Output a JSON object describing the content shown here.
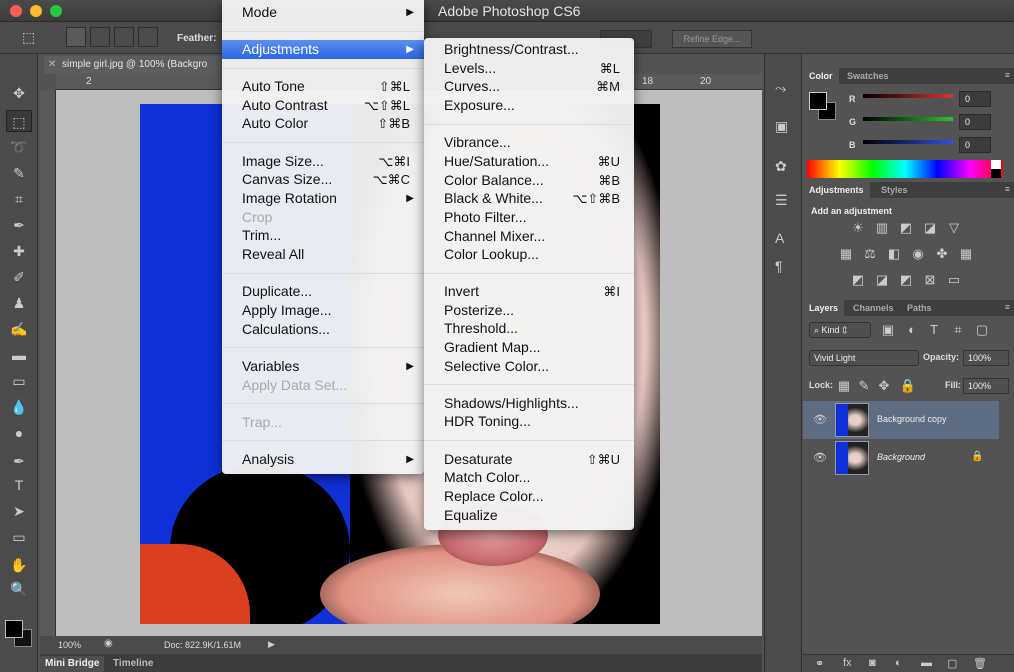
{
  "window": {
    "title": "Adobe Photoshop CS6"
  },
  "options_bar": {
    "feather_label": "Feather:",
    "refine_edge_label": "Refine Edge..."
  },
  "document": {
    "tab_label": "simple girl.jpg @ 100% (Backgro",
    "ruler_numbers": [
      "2",
      "18",
      "20"
    ],
    "zoom": "100%",
    "doc_size": "Doc: 822.9K/1.61M"
  },
  "bottom_tabs": [
    "Mini Bridge",
    "Timeline"
  ],
  "image_menu": {
    "items": [
      {
        "label": "Mode",
        "shortcut": "",
        "arrow": "▶",
        "state": "normal"
      },
      {
        "label": "Adjustments",
        "shortcut": "",
        "arrow": "▶",
        "state": "highlighted"
      },
      {
        "label": "Auto Tone",
        "shortcut": "⇧⌘L",
        "arrow": "",
        "state": "normal"
      },
      {
        "label": "Auto Contrast",
        "shortcut": "⌥⇧⌘L",
        "arrow": "",
        "state": "normal"
      },
      {
        "label": "Auto Color",
        "shortcut": "⇧⌘B",
        "arrow": "",
        "state": "normal"
      },
      {
        "label": "Image Size...",
        "shortcut": "⌥⌘I",
        "arrow": "",
        "state": "normal"
      },
      {
        "label": "Canvas Size...",
        "shortcut": "⌥⌘C",
        "arrow": "",
        "state": "normal"
      },
      {
        "label": "Image Rotation",
        "shortcut": "",
        "arrow": "▶",
        "state": "normal"
      },
      {
        "label": "Crop",
        "shortcut": "",
        "arrow": "",
        "state": "disabled"
      },
      {
        "label": "Trim...",
        "shortcut": "",
        "arrow": "",
        "state": "normal"
      },
      {
        "label": "Reveal All",
        "shortcut": "",
        "arrow": "",
        "state": "normal"
      },
      {
        "label": "Duplicate...",
        "shortcut": "",
        "arrow": "",
        "state": "normal"
      },
      {
        "label": "Apply Image...",
        "shortcut": "",
        "arrow": "",
        "state": "normal"
      },
      {
        "label": "Calculations...",
        "shortcut": "",
        "arrow": "",
        "state": "normal"
      },
      {
        "label": "Variables",
        "shortcut": "",
        "arrow": "▶",
        "state": "normal"
      },
      {
        "label": "Apply Data Set...",
        "shortcut": "",
        "arrow": "",
        "state": "disabled"
      },
      {
        "label": "Trap...",
        "shortcut": "",
        "arrow": "",
        "state": "disabled"
      },
      {
        "label": "Analysis",
        "shortcut": "",
        "arrow": "▶",
        "state": "normal"
      }
    ]
  },
  "adjustments_menu": {
    "items": [
      {
        "label": "Brightness/Contrast...",
        "shortcut": ""
      },
      {
        "label": "Levels...",
        "shortcut": "⌘L"
      },
      {
        "label": "Curves...",
        "shortcut": "⌘M"
      },
      {
        "label": "Exposure...",
        "shortcut": ""
      },
      {
        "label": "Vibrance...",
        "shortcut": ""
      },
      {
        "label": "Hue/Saturation...",
        "shortcut": "⌘U"
      },
      {
        "label": "Color Balance...",
        "shortcut": "⌘B"
      },
      {
        "label": "Black & White...",
        "shortcut": "⌥⇧⌘B"
      },
      {
        "label": "Photo Filter...",
        "shortcut": ""
      },
      {
        "label": "Channel Mixer...",
        "shortcut": ""
      },
      {
        "label": "Color Lookup...",
        "shortcut": ""
      },
      {
        "label": "Invert",
        "shortcut": "⌘I"
      },
      {
        "label": "Posterize...",
        "shortcut": ""
      },
      {
        "label": "Threshold...",
        "shortcut": ""
      },
      {
        "label": "Gradient Map...",
        "shortcut": ""
      },
      {
        "label": "Selective Color...",
        "shortcut": ""
      },
      {
        "label": "Shadows/Highlights...",
        "shortcut": ""
      },
      {
        "label": "HDR Toning...",
        "shortcut": ""
      },
      {
        "label": "Desaturate",
        "shortcut": "⇧⌘U"
      },
      {
        "label": "Match Color...",
        "shortcut": ""
      },
      {
        "label": "Replace Color...",
        "shortcut": ""
      },
      {
        "label": "Equalize",
        "shortcut": ""
      }
    ]
  },
  "color_panel": {
    "tabs": [
      "Color",
      "Swatches"
    ],
    "channels": [
      {
        "label": "R",
        "value": "0",
        "color": "#e03030"
      },
      {
        "label": "G",
        "value": "0",
        "color": "#30c030"
      },
      {
        "label": "B",
        "value": "0",
        "color": "#3050e0"
      }
    ]
  },
  "adjustments_panel": {
    "tabs": [
      "Adjustments",
      "Styles"
    ],
    "heading": "Add an adjustment"
  },
  "layers_panel": {
    "tabs": [
      "Layers",
      "Channels",
      "Paths"
    ],
    "kind_label": "Kind",
    "blend_mode": "Vivid Light",
    "opacity_label": "Opacity:",
    "opacity_value": "100%",
    "lock_label": "Lock:",
    "fill_label": "Fill:",
    "fill_value": "100%",
    "layers": [
      {
        "name": "Background copy",
        "selected": true
      },
      {
        "name": "Background",
        "selected": false
      }
    ]
  },
  "accent_color": "#2a66e0"
}
